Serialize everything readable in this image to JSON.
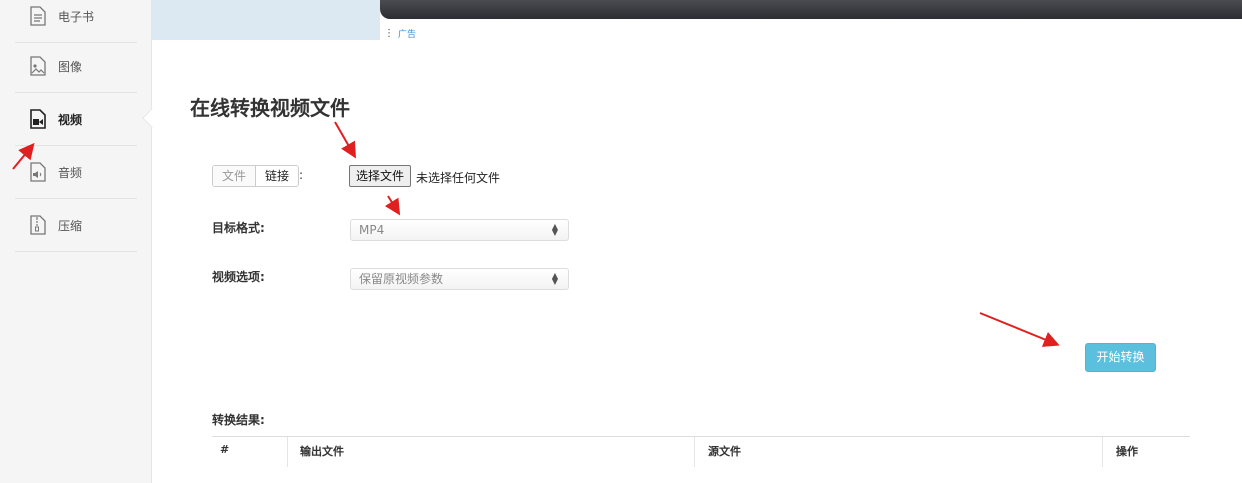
{
  "sidebar": {
    "items": [
      {
        "label": "电子书",
        "icon": "ebook-icon"
      },
      {
        "label": "图像",
        "icon": "image-icon"
      },
      {
        "label": "视频",
        "icon": "video-icon",
        "active": true
      },
      {
        "label": "音频",
        "icon": "audio-icon"
      },
      {
        "label": "压缩",
        "icon": "archive-icon"
      }
    ]
  },
  "ad": {
    "label": "广告"
  },
  "main": {
    "title": "在线转换视频文件",
    "source_toggle": {
      "file_label": "文件",
      "link_label": "链接",
      "colon": ":"
    },
    "file_input": {
      "button_label": "选择文件",
      "status": "未选择任何文件"
    },
    "target_format": {
      "label": "目标格式:",
      "value": "MP4"
    },
    "video_options": {
      "label": "视频选项:",
      "value": "保留原视频参数"
    },
    "start_button": "开始转换",
    "results": {
      "label": "转换结果:",
      "columns": [
        "#",
        "输出文件",
        "源文件",
        "操作"
      ]
    }
  },
  "colors": {
    "accent": "#5bc0de",
    "annotation_arrow": "#e02020"
  }
}
